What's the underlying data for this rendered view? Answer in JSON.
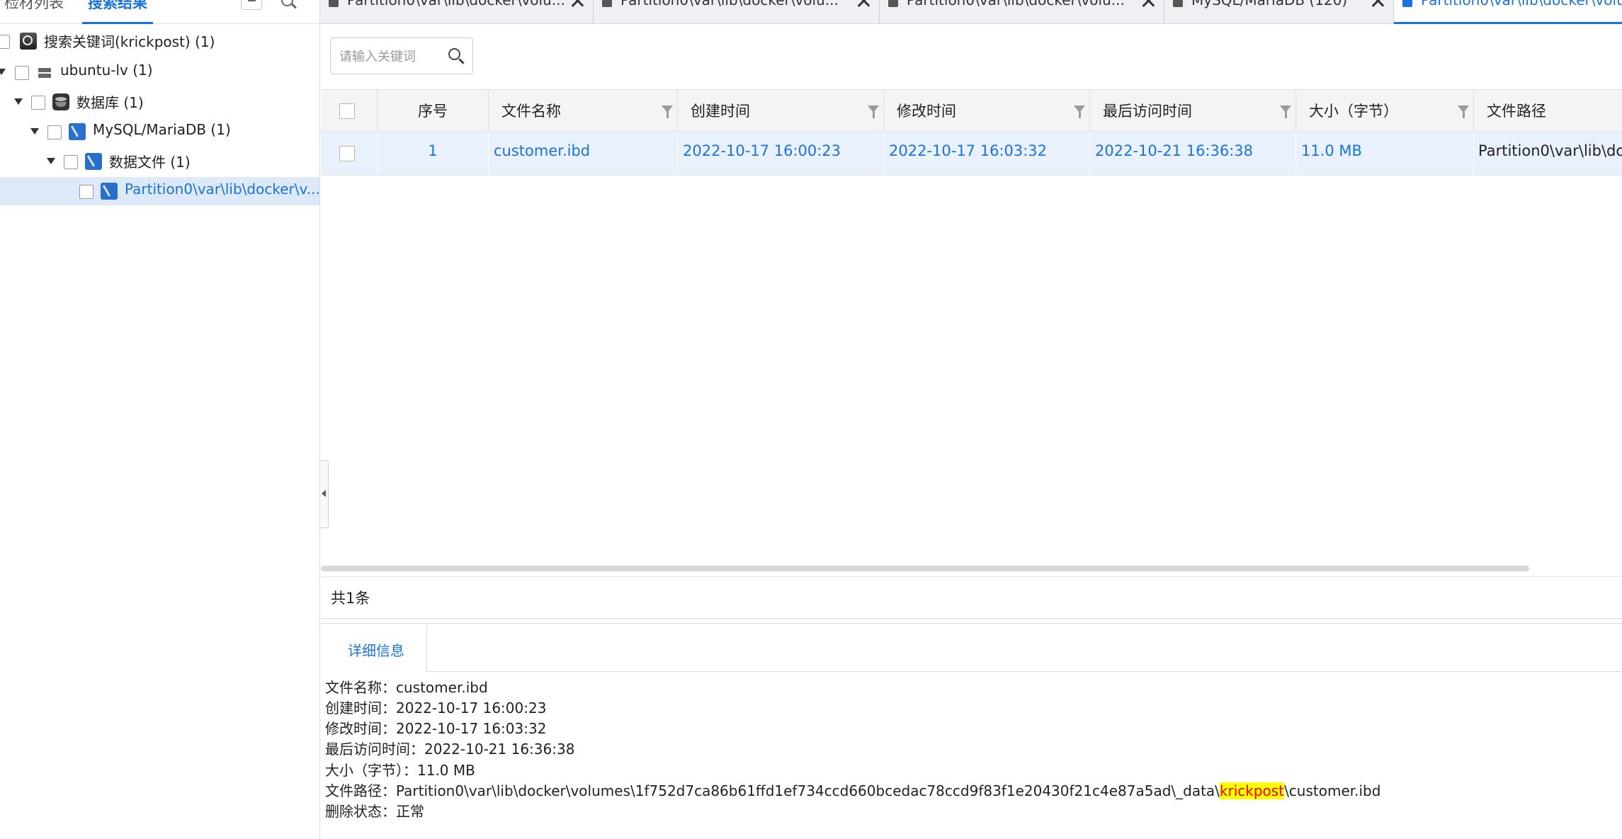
{
  "left_panel": {
    "tabs": [
      "检材列表",
      "搜索结果"
    ],
    "tree": [
      {
        "label": "搜索关键词(krickpost) (1)",
        "icon": "search-result-icon"
      },
      {
        "label": "ubuntu-lv (1)",
        "icon": "disk-icon"
      },
      {
        "label": "数据库 (1)",
        "icon": "database-icon"
      },
      {
        "label": "MySQL/MariaDB (1)",
        "icon": "mysql-icon"
      },
      {
        "label": "数据文件 (1)",
        "icon": "mysql-icon"
      },
      {
        "label": "Partition0\\var\\lib\\docker\\v...",
        "icon": "mysql-icon",
        "selected": true
      }
    ]
  },
  "top_tabs": [
    {
      "label": "Partition0\\var\\lib\\docker\\volu...",
      "icon": "document-icon"
    },
    {
      "label": "Partition0\\var\\lib\\docker\\volu...",
      "icon": "document-icon"
    },
    {
      "label": "Partition0\\var\\lib\\docker\\volu...",
      "icon": "document-icon"
    },
    {
      "label": "MySQL/MariaDB (120)",
      "icon": "document-icon"
    },
    {
      "label": "Partition0\\var\\lib\\docker\\volu",
      "icon": "search-document-icon",
      "active": true
    }
  ],
  "search": {
    "placeholder": "请输入关键词",
    "value": ""
  },
  "table": {
    "columns": [
      "序号",
      "文件名称",
      "创建时间",
      "修改时间",
      "最后访问时间",
      "大小（字节）",
      "文件路径"
    ],
    "rows": [
      {
        "index": "1",
        "name": "customer.ibd",
        "created": "2022-10-17 16:00:23",
        "modified": "2022-10-17 16:03:32",
        "accessed": "2022-10-21 16:36:38",
        "size": "11.0 MB",
        "path": "Partition0\\var\\lib\\do"
      }
    ]
  },
  "count_text": "共1条",
  "detail": {
    "tab": "详细信息",
    "name": {
      "label": "文件名称：",
      "value": "customer.ibd"
    },
    "created": {
      "label": "创建时间：",
      "value": "2022-10-17 16:00:23"
    },
    "modified": {
      "label": "修改时间：",
      "value": "2022-10-17 16:03:32"
    },
    "accessed": {
      "label": "最后访问时间：",
      "value": "2022-10-21 16:36:38"
    },
    "size": {
      "label": "大小（字节）：",
      "value": "11.0 MB"
    },
    "path": {
      "label": "文件路径：",
      "prefix": "Partition0\\var\\lib\\docker\\volumes\\1f752d7ca86b61ffd1ef734ccd660bcedac78ccd9f83f1e20430f21c4e87a5ad\\_data\\",
      "keyword": "krickpost",
      "suffix": "\\customer.ibd"
    },
    "deleted": {
      "label": "删除状态：",
      "value": "正常"
    }
  },
  "colors": {
    "accent": "#1a73d9",
    "selected_row": "#e8f1fc",
    "highlight_bg": "#ffff00",
    "highlight_fg": "#e60000"
  }
}
